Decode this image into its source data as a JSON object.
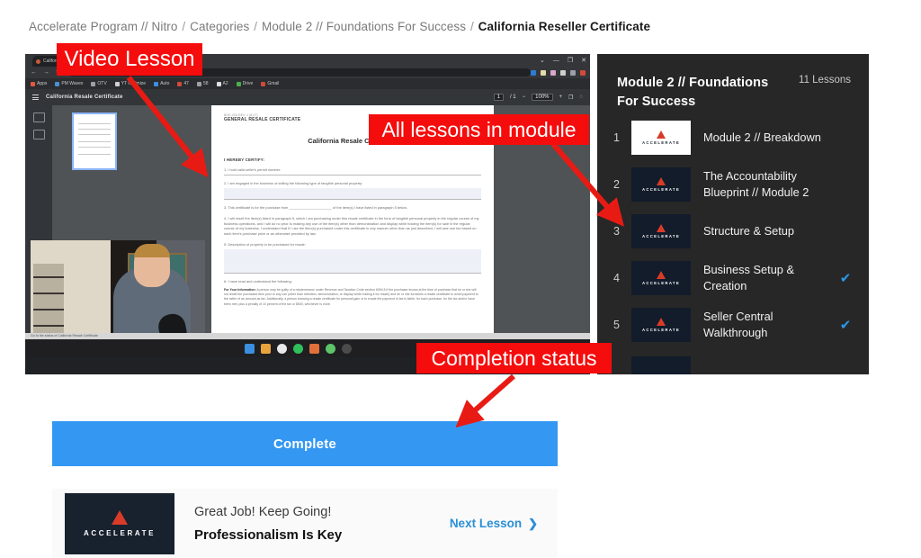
{
  "breadcrumb": {
    "items": [
      "Accelerate Program // Nitro",
      "Categories",
      "Module 2 // Foundations For Success"
    ],
    "current": "California Reseller Certificate",
    "separator": "/"
  },
  "video": {
    "browser": {
      "tab_title": "California Resale Certificate",
      "window_buttons": [
        "⌄",
        "—",
        "❐",
        "✕"
      ],
      "nav_back": "←",
      "nav_forward": "→",
      "nav_reload": "↻",
      "bookmarks": [
        "Apps",
        "PM Waves",
        "OTV",
        "YT Optimize",
        "Auto",
        "47",
        "58",
        "A2",
        "Drive",
        "Gmail"
      ]
    },
    "pdf_toolbar": {
      "document_name": "California Resale Certificate",
      "page_current": "1",
      "page_total": "/ 1",
      "zoom": "100%",
      "zoom_out": "−",
      "zoom_in": "+",
      "fit": "❐",
      "rotate": "◌"
    },
    "document": {
      "form_code": "BOE-230-REV. 1 (8-17)",
      "header": "GENERAL RESALE CERTIFICATE",
      "header_right": "CALIFORNIA DEPARTMENT OF TAX AND FEE ADMINISTRATION",
      "title": "California Resale Certificate",
      "certify": "I HEREBY CERTIFY:",
      "lines": [
        "1. I hold valid seller's permit number:",
        "2. I am engaged in the business of selling the following type of tangible personal property:",
        "3. This certificate is for the purchase from ______________________ of the item(s) I have listed in paragraph 5 below.",
        "4. I will resell the item(s) listed in paragraph 5, which I am purchasing under this resale certificate in the form of tangible personal property in the regular course of my business operations, and I will do no prior to making any use of the item(s) other than demonstration and display while holding the item(s) for sale in the regular course of my business. I understand that if I use the item(s) purchased under this certificate in any manner other than as just described, I will owe use tax based on each item's purchase price or as otherwise provided by law.",
        "5. Description of property to be purchased for resale:",
        "6. I have read and understand the following:"
      ],
      "note_label": "For Your Information:",
      "note": "A person may be guilty of a misdemeanor under Revenue and Taxation Code section 6094.5 if the purchaser knows at the time of purchase that he or she will not resell the purchased item prior to any use (other than retention, demonstration, or display while holding it for resale) and he or she furnishes a resale certificate to avoid payment to the seller of an amount as tax. Additionally, a person knowing a resale certificate for personal gain or to evade the payment of tax is liable, for each purchase, for the tax and/or have been met, plus a penalty of 10 percent of the tax or $500, whichever is more."
    },
    "taskbar_status": "Go to the status of California Resale Certificate"
  },
  "lessons_panel": {
    "title": "Module 2 // Foundations For Success",
    "count_label": "11 Lessons",
    "logo_word": "ACCELERATE",
    "check_icon": "✔",
    "items": [
      {
        "number": "1",
        "name": "Module 2 // Breakdown",
        "completed": false,
        "thumb": "white"
      },
      {
        "number": "2",
        "name": "The Accountability Blueprint // Module 2",
        "completed": false,
        "thumb": "dark"
      },
      {
        "number": "3",
        "name": "Structure & Setup",
        "completed": false,
        "thumb": "dark"
      },
      {
        "number": "4",
        "name": "Business Setup & Creation",
        "completed": true,
        "thumb": "dark"
      },
      {
        "number": "5",
        "name": "Seller Central Walkthrough",
        "completed": true,
        "thumb": "dark"
      }
    ]
  },
  "bottom": {
    "complete_button": "Complete",
    "next_subtitle": "Great Job! Keep Going!",
    "next_title": "Professionalism Is Key",
    "next_link": "Next Lesson",
    "next_chevron": "❯",
    "logo_word": "ACCELERATE"
  },
  "annotations": [
    {
      "label": "Video Lesson"
    },
    {
      "label": "All lessons in module"
    },
    {
      "label": "Completion status"
    }
  ],
  "colors": {
    "accent_blue": "#3498f3",
    "annotation_red": "#f50c0c",
    "check_blue": "#2b97e8",
    "logo_red": "#d93b29",
    "sidebar_bg": "#272727"
  }
}
